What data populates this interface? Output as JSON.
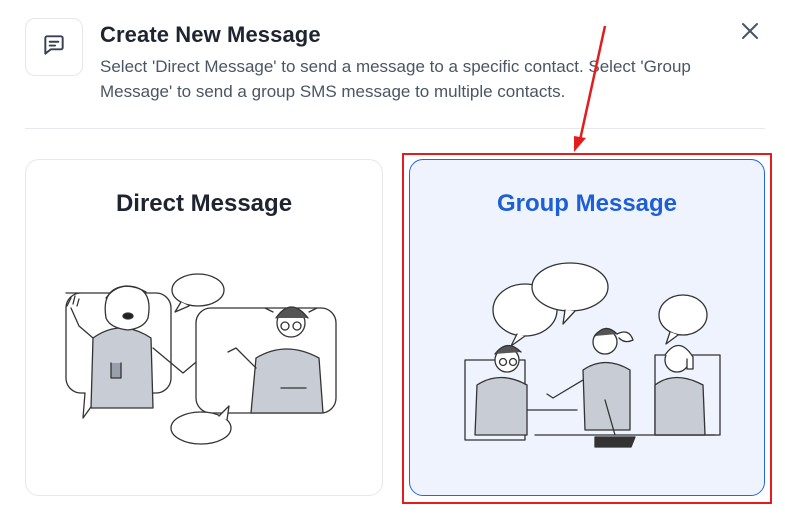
{
  "dialog": {
    "title": "Create New Message",
    "subtitle": "Select 'Direct Message' to send a message to a specific contact. Select 'Group Message' to send a group SMS message to multiple contacts.",
    "header_icon": "message-square-icon",
    "close_icon": "close-icon"
  },
  "options": [
    {
      "label": "Direct Message",
      "selected": false,
      "illustration": "two-people-chatting-illustration"
    },
    {
      "label": "Group Message",
      "selected": true,
      "illustration": "group-chat-illustration"
    }
  ],
  "colors": {
    "accent": "#2563eb",
    "selected_bg": "#eef3fd",
    "annotation": "#e11d1d"
  }
}
